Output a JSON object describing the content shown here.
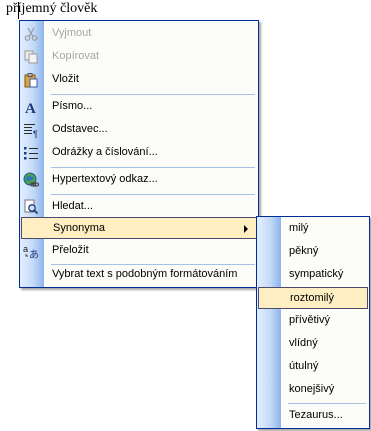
{
  "document": {
    "text": "příjemný člověk"
  },
  "context_menu": {
    "items": [
      {
        "label": "Vyjmout",
        "icon": "scissors-icon",
        "disabled": true
      },
      {
        "label": "Kopírovat",
        "icon": "copy-icon",
        "disabled": true
      },
      {
        "label": "Vložit",
        "icon": "paste-icon",
        "disabled": false
      },
      {
        "label": "Písmo...",
        "icon": "font-icon",
        "disabled": false
      },
      {
        "label": "Odstavec...",
        "icon": "paragraph-icon",
        "disabled": false
      },
      {
        "label": "Odrážky a číslování...",
        "icon": "bullets-icon",
        "disabled": false
      },
      {
        "label": "Hypertextový odkaz...",
        "icon": "hyperlink-icon",
        "disabled": false
      },
      {
        "label": "Hledat...",
        "icon": "search-icon",
        "disabled": false
      },
      {
        "label": "Synonyma",
        "icon": "",
        "disabled": false,
        "submenu": true,
        "highlighted": true
      },
      {
        "label": "Přeložit",
        "icon": "translate-icon",
        "disabled": false
      },
      {
        "label": "Vybrat text s podobným formátováním",
        "icon": "",
        "disabled": false
      }
    ]
  },
  "synonyms_menu": {
    "items": [
      {
        "label": "milý"
      },
      {
        "label": "pěkný"
      },
      {
        "label": "sympatický"
      },
      {
        "label": "roztomilý",
        "highlighted": true
      },
      {
        "label": "přívětivý"
      },
      {
        "label": "vlídný"
      },
      {
        "label": "útulný"
      },
      {
        "label": "konejšivý"
      },
      {
        "label": "Tezaurus..."
      }
    ]
  },
  "colors": {
    "menu_border": "#002d96",
    "highlight_bg": "#ffeec2",
    "highlight_border": "#4b4b6f",
    "gutter_light": "#e3efff",
    "gutter_dark": "#8eb4ea",
    "disabled_text": "#a5a5a5"
  }
}
